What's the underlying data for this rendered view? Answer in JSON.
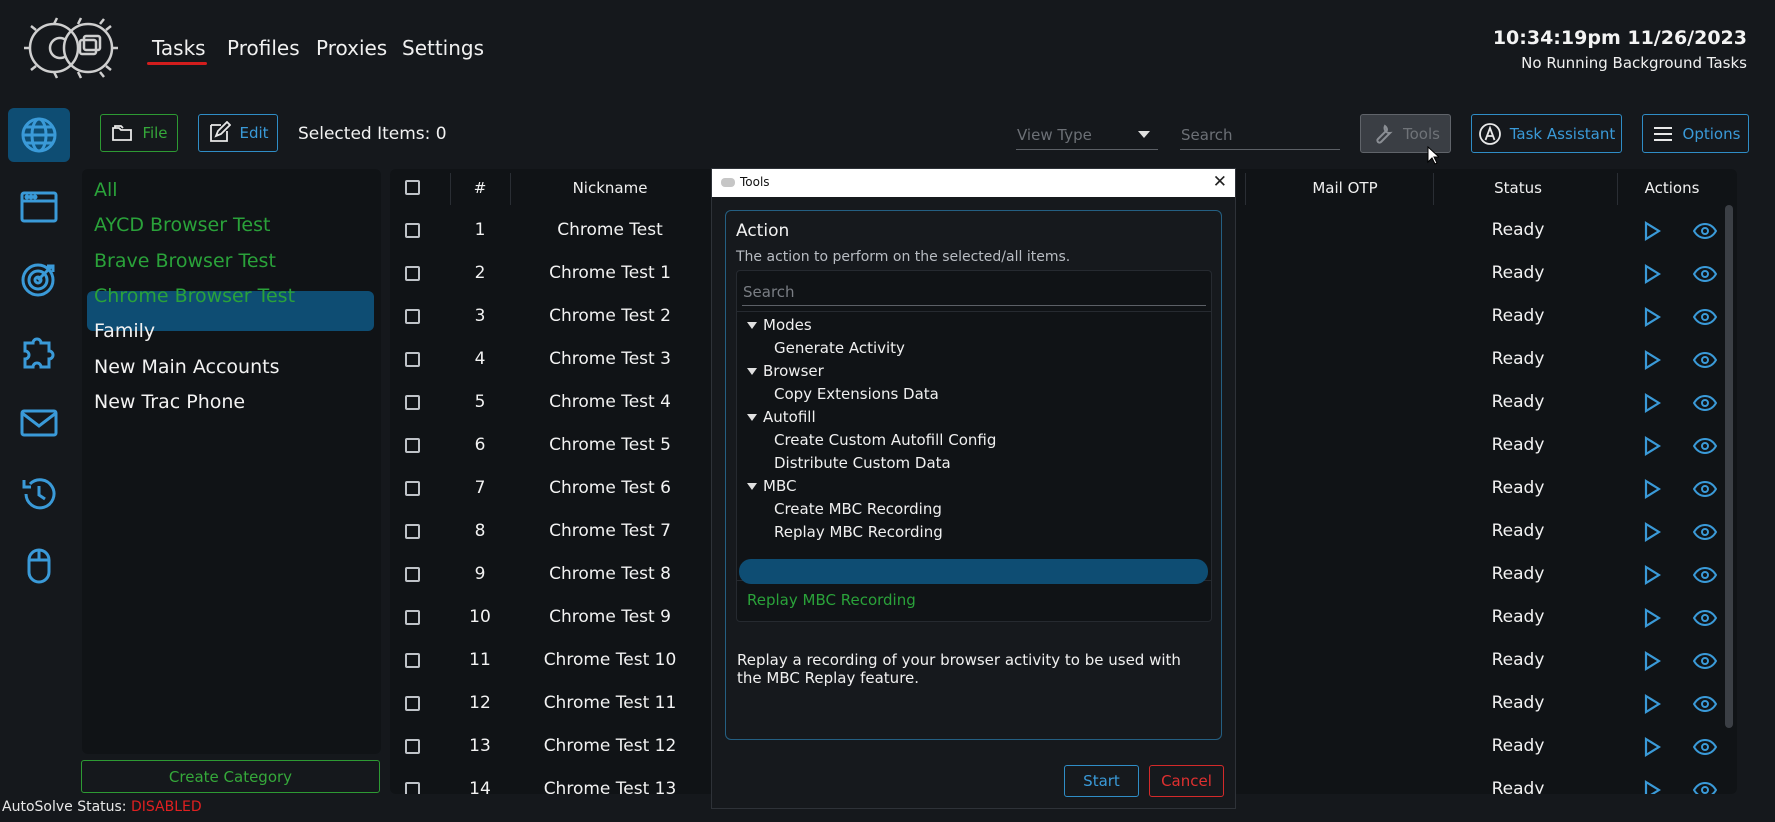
{
  "header": {
    "nav": [
      "Tasks",
      "Profiles",
      "Proxies",
      "Settings"
    ],
    "active_nav": "Tasks",
    "clock": "10:34:19pm 11/26/2023",
    "background_status": "No Running Background Tasks"
  },
  "rail": [
    "globe-icon",
    "browser-window-icon",
    "target-icon",
    "puzzle-icon",
    "mail-icon",
    "history-icon",
    "mouse-icon"
  ],
  "toolbar": {
    "file_label": "File",
    "edit_label": "Edit",
    "selected_items": "Selected Items: 0",
    "view_type_placeholder": "View Type",
    "search_placeholder": "Search",
    "tools_label": "Tools",
    "task_assistant_label": "Task Assistant",
    "options_label": "Options"
  },
  "categories": {
    "items": [
      {
        "label": "All",
        "color": "#2aa23a"
      },
      {
        "label": "AYCD Browser Test",
        "color": "#2aa23a"
      },
      {
        "label": "Brave Browser Test",
        "color": "#2aa23a"
      },
      {
        "label": "Chrome Browser Test",
        "color": "#2aa23a"
      },
      {
        "label": "Family",
        "color": "#f2f2f2"
      },
      {
        "label": "New Main Accounts",
        "color": "#f2f2f2"
      },
      {
        "label": "New Trac Phone",
        "color": "#f2f2f2"
      }
    ],
    "selected": "Chrome Browser Test",
    "create_label": "Create Category"
  },
  "autosolve": {
    "label": "AutoSolve Status:",
    "value": "DISABLED"
  },
  "table": {
    "columns": {
      "num": "#",
      "nickname": "Nickname",
      "mail_otp": "Mail OTP",
      "status": "Status",
      "actions": "Actions"
    },
    "rows": [
      {
        "num": "1",
        "nickname": "Chrome Test",
        "status": "Ready"
      },
      {
        "num": "2",
        "nickname": "Chrome Test 1",
        "status": "Ready"
      },
      {
        "num": "3",
        "nickname": "Chrome Test 2",
        "status": "Ready"
      },
      {
        "num": "4",
        "nickname": "Chrome Test 3",
        "status": "Ready"
      },
      {
        "num": "5",
        "nickname": "Chrome Test 4",
        "status": "Ready"
      },
      {
        "num": "6",
        "nickname": "Chrome Test 5",
        "status": "Ready"
      },
      {
        "num": "7",
        "nickname": "Chrome Test 6",
        "status": "Ready"
      },
      {
        "num": "8",
        "nickname": "Chrome Test 7",
        "status": "Ready"
      },
      {
        "num": "9",
        "nickname": "Chrome Test 8",
        "status": "Ready"
      },
      {
        "num": "10",
        "nickname": "Chrome Test 9",
        "status": "Ready"
      },
      {
        "num": "11",
        "nickname": "Chrome Test 10",
        "status": "Ready"
      },
      {
        "num": "12",
        "nickname": "Chrome Test 11",
        "status": "Ready"
      },
      {
        "num": "13",
        "nickname": "Chrome Test 12",
        "status": "Ready"
      },
      {
        "num": "14",
        "nickname": "Chrome Test 13",
        "status": "Ready"
      }
    ]
  },
  "modal": {
    "title": "Tools",
    "action_heading": "Action",
    "action_sub": "The action to perform on the selected/all items.",
    "search_placeholder": "Search",
    "groups": [
      {
        "label": "Modes",
        "items": [
          "Generate Activity"
        ]
      },
      {
        "label": "Browser",
        "items": [
          "Copy Extensions Data"
        ]
      },
      {
        "label": "Autofill",
        "items": [
          "Create Custom Autofill Config",
          "Distribute Custom Data"
        ]
      },
      {
        "label": "MBC",
        "items": [
          "Create MBC Recording",
          "Replay MBC Recording"
        ]
      }
    ],
    "selected_item": "Replay MBC Recording",
    "selected_display": "Replay MBC Recording",
    "description": "Replay a recording of your browser activity to be used with the MBC Replay feature.",
    "start_label": "Start",
    "cancel_label": "Cancel"
  },
  "colors": {
    "accent_blue": "#3a9ad8",
    "accent_green": "#2aa23a",
    "active_bg": "#0e4d73",
    "danger": "#e02020"
  }
}
